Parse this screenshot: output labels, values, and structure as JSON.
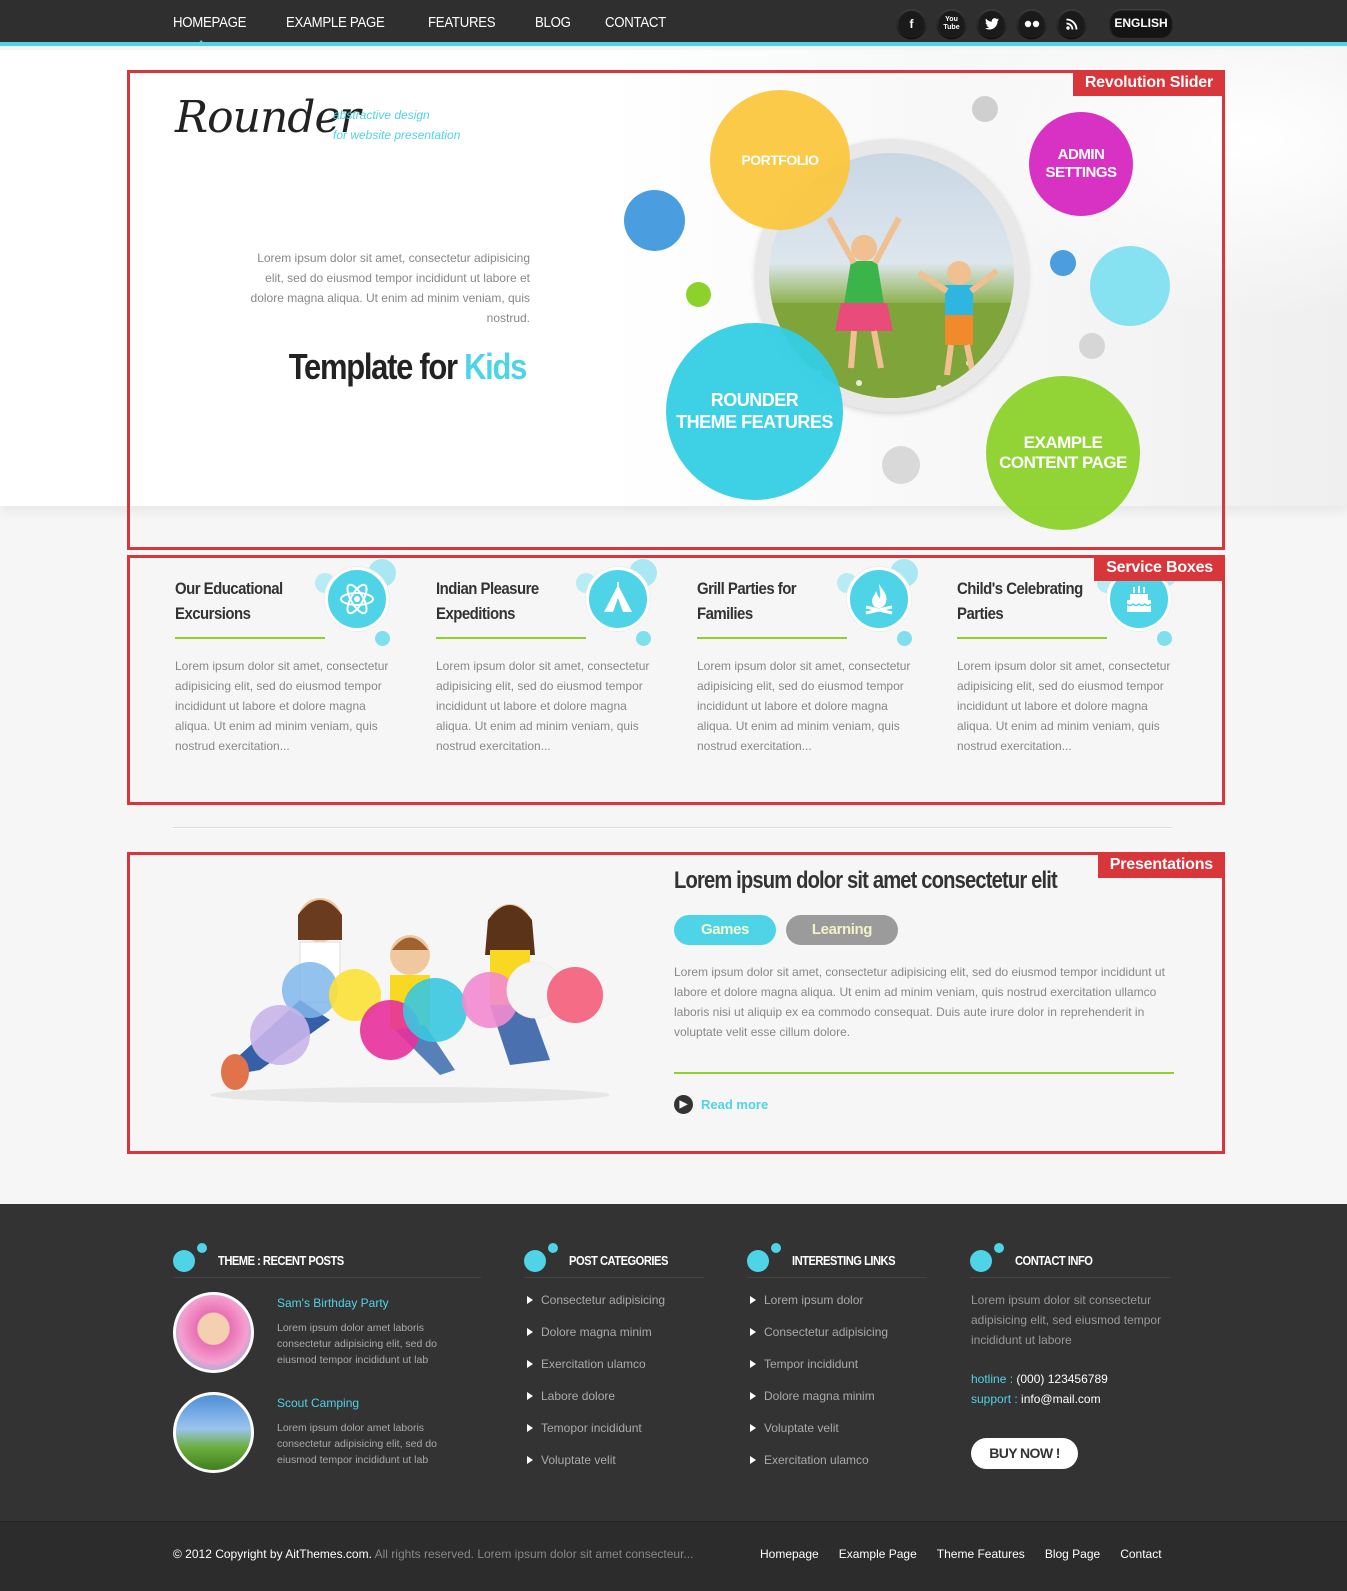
{
  "nav": {
    "items": [
      "HOMEPAGE",
      "EXAMPLE PAGE",
      "FEATURES",
      "BLOG",
      "CONTACT"
    ],
    "social": [
      "f",
      "You Tube",
      "t",
      "flickr",
      "rss"
    ],
    "social_icons": [
      "facebook-icon",
      "youtube-icon",
      "twitter-icon",
      "flickr-icon",
      "rss-icon"
    ],
    "language": "ENGLISH"
  },
  "annotations": {
    "slider": "Revolution Slider",
    "services": "Service Boxes",
    "presentations": "Presentations"
  },
  "hero": {
    "logo": "Rounder",
    "tagline_1": "abstractive design",
    "tagline_2": "for website presentation",
    "text": "Lorem ipsum dolor sit amet, consectetur adipisicing elit, sed do eiusmod tempor incididunt ut labore et dolore magna aliqua. Ut enim ad minim veniam, quis nostrud.",
    "title_main": "Template for ",
    "title_accent": "Kids",
    "bubbles": {
      "portfolio": "PORTFOLIO",
      "admin_1": "ADMIN",
      "admin_2": "SETTINGS",
      "features_1": "ROUNDER",
      "features_2": "THEME FEATURES",
      "example_1": "EXAMPLE",
      "example_2": "CONTENT PAGE"
    }
  },
  "services": [
    {
      "title_1": "Our Educational",
      "title_2": "Excursions",
      "icon": "atom-icon",
      "text": "Lorem ipsum dolor sit amet, consectetur adipisicing elit, sed do eiusmod tempor incididunt ut labore et dolore magna aliqua. Ut enim ad minim veniam, quis nostrud exercitation..."
    },
    {
      "title_1": "Indian Pleasure",
      "title_2": "Expeditions",
      "icon": "tent-icon",
      "text": "Lorem ipsum dolor sit amet, consectetur adipisicing elit, sed do eiusmod tempor incididunt ut labore et dolore magna aliqua. Ut enim ad minim veniam, quis nostrud exercitation..."
    },
    {
      "title_1": "Grill Parties for",
      "title_2": "Families",
      "icon": "campfire-icon",
      "text": "Lorem ipsum dolor sit amet, consectetur adipisicing elit, sed do eiusmod tempor incididunt ut labore et dolore magna aliqua. Ut enim ad minim veniam, quis nostrud exercitation..."
    },
    {
      "title_1": "Child's Celebrating",
      "title_2": "Parties",
      "icon": "cake-icon",
      "text": "Lorem ipsum dolor sit amet, consectetur adipisicing elit, sed do eiusmod tempor incididunt ut labore et dolore magna aliqua. Ut enim ad minim veniam, quis nostrud exercitation..."
    }
  ],
  "presentation": {
    "title": "Lorem ipsum dolor sit amet consectetur elit",
    "tab_games": "Games",
    "tab_learning": "Learning",
    "text": "Lorem ipsum dolor sit amet, consectetur adipisicing elit, sed do eiusmod tempor incididunt ut labore et dolore magna aliqua. Ut enim ad minim veniam, quis nostrud exercitation ullamco laboris nisi ut aliquip ex ea commodo consequat. Duis aute irure dolor in reprehenderit in voluptate velit esse cillum dolore.",
    "read_more": "Read more"
  },
  "footer": {
    "recent_title": "THEME : RECENT POSTS",
    "posts": [
      {
        "title": "Sam's Birthday Party",
        "text": "Lorem ipsum dolor amet laboris consectetur adipisicing elit, sed do eiusmod tempor incididunt ut lab"
      },
      {
        "title": "Scout Camping",
        "text": "Lorem ipsum dolor amet laboris consectetur adipisicing elit, sed do eiusmod tempor incididunt ut lab"
      }
    ],
    "categories_title": "POST CATEGORIES",
    "categories": [
      "Consectetur adipisicing",
      "Dolore magna minim",
      "Exercitation ulamco",
      "Labore dolore",
      "Temopor incididunt",
      "Voluptate velit"
    ],
    "links_title": "INTERESTING LINKS",
    "links": [
      "Lorem ipsum dolor",
      "Consectetur adipisicing",
      "Tempor incididunt",
      "Dolore magna minim",
      "Voluptate velit",
      "Exercitation ulamco"
    ],
    "contact_title": "CONTACT INFO",
    "contact_text": "Lorem ipsum dolor sit consectetur adipisicing elit, sed eiusmod tempor incididunt ut labore",
    "hotline_label": "hotline :",
    "hotline": "(000) 123456789",
    "support_label": "support :",
    "support": "info@mail.com",
    "buy_now": "BUY NOW !",
    "copyright": "© 2012 Copyright by AitThemes.com.",
    "copyright_dim": "All rights reserved. Lorem ipsum dolor sit amet consecteur...",
    "bottom_nav": [
      "Homepage",
      "Example Page",
      "Theme Features",
      "Blog Page",
      "Contact"
    ]
  },
  "colors": {
    "accent": "#4fd3e7",
    "green": "#8cd22b",
    "annotation_red": "#d8363b",
    "yellow_bubble": "#fcc63a",
    "magenta_bubble": "#d832c4",
    "green_bubble": "#8cd22b"
  }
}
